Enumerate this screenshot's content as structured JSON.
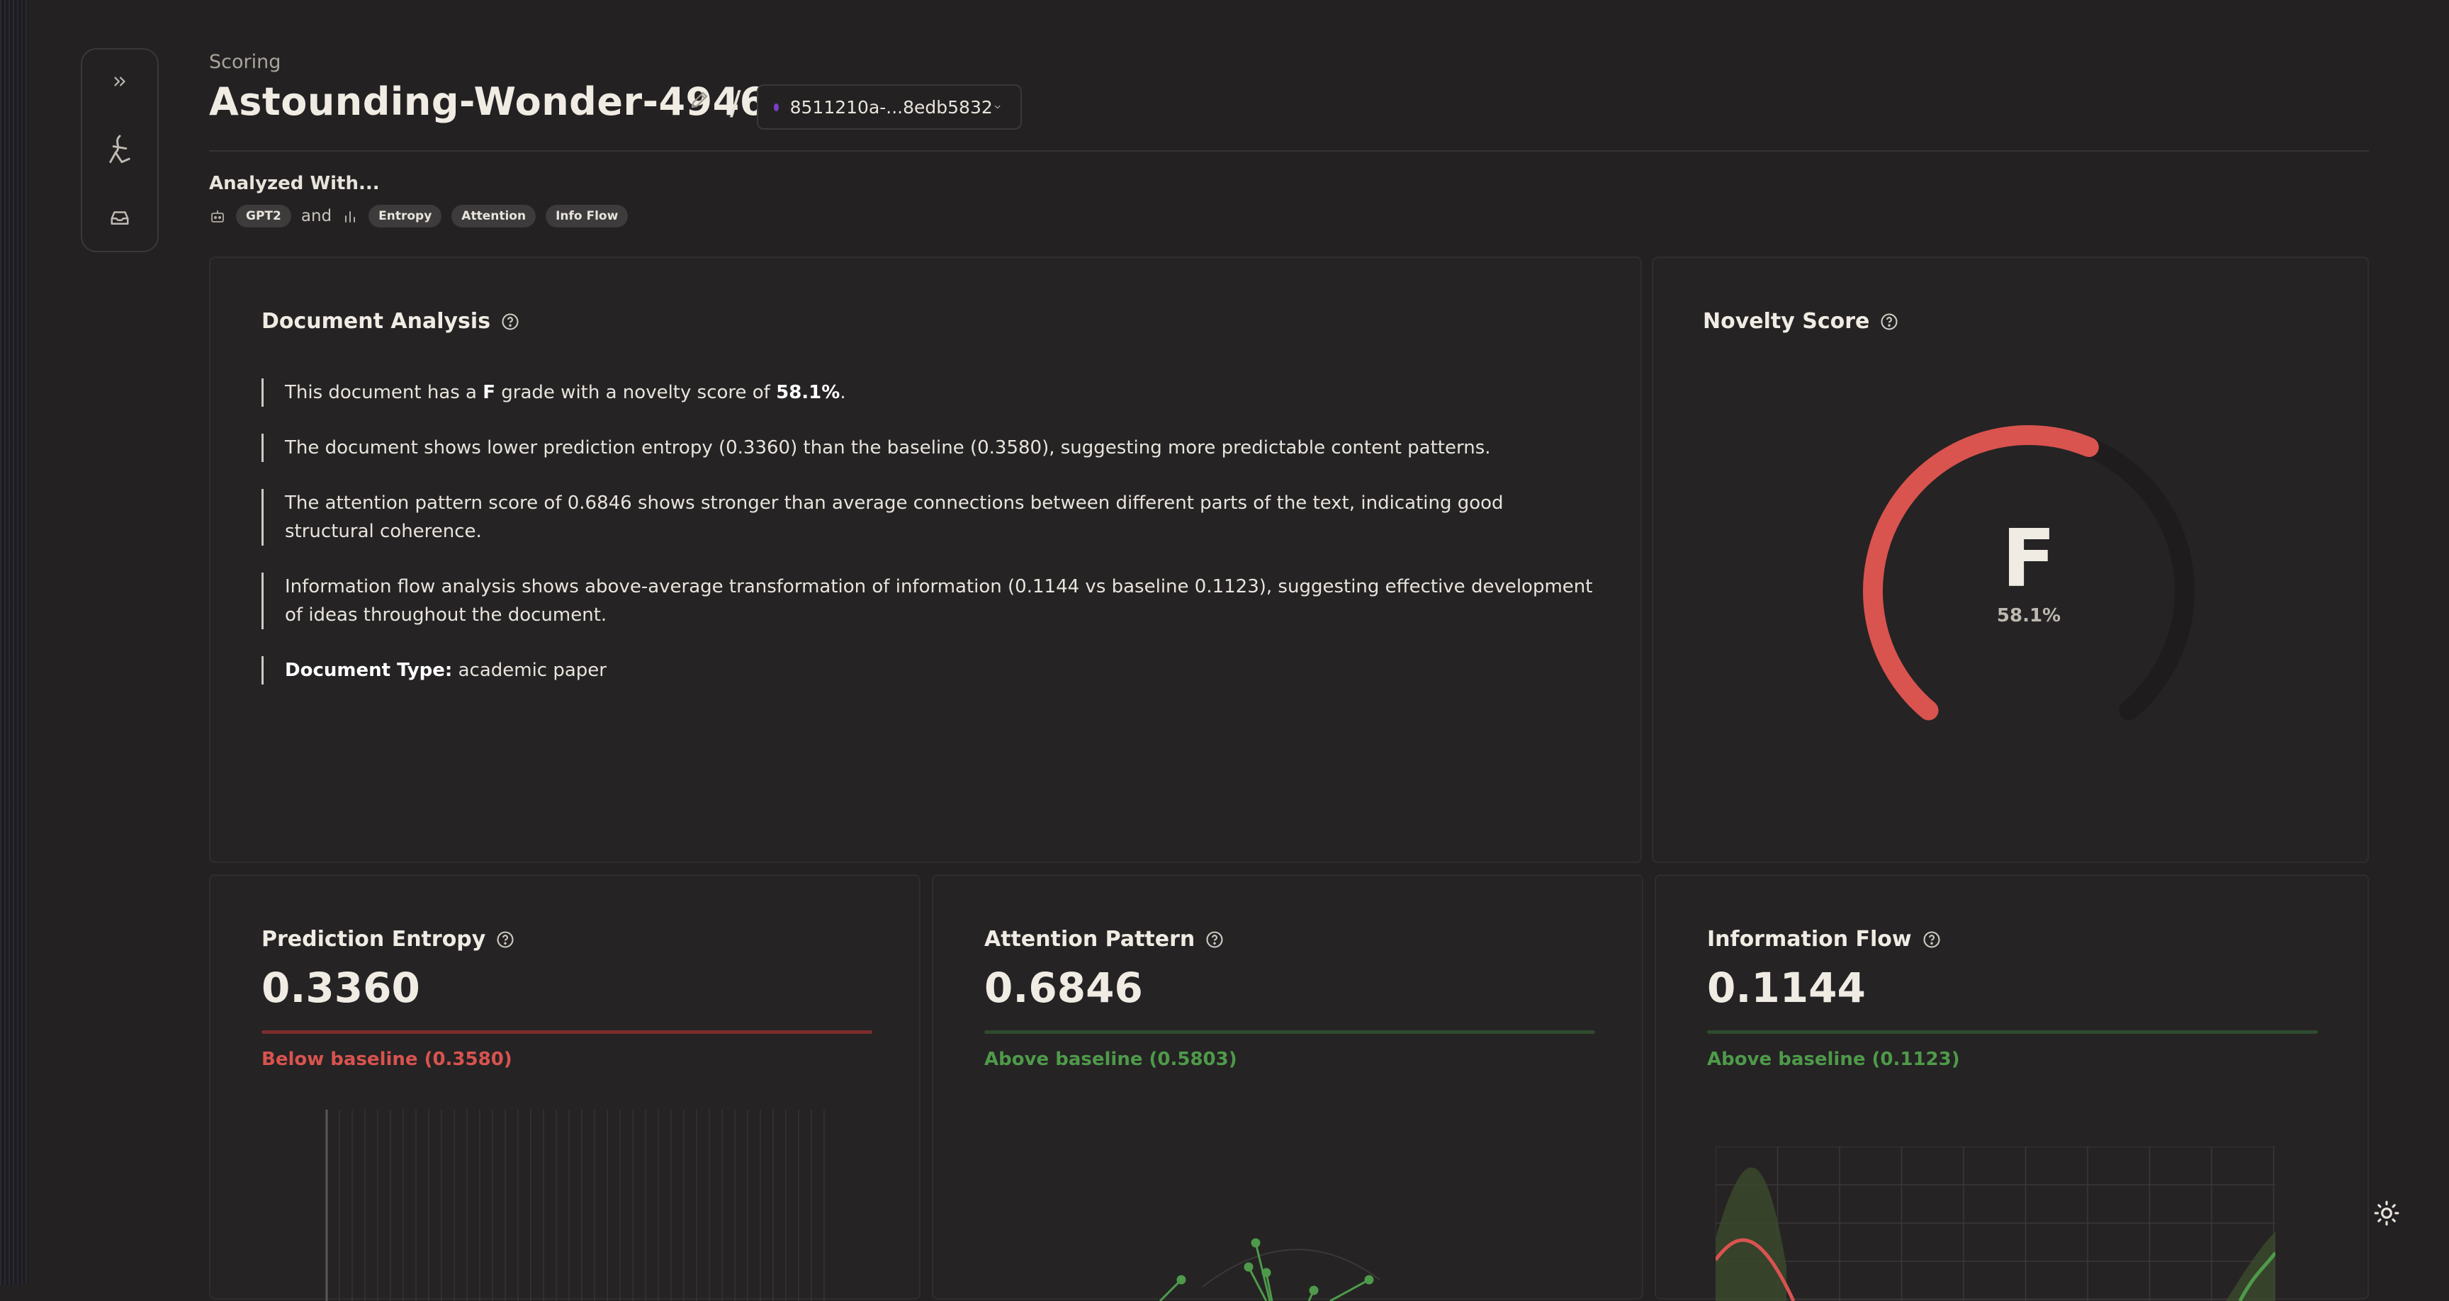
{
  "sidebar": {
    "expand_icon": "chevrons-right-icon",
    "logo_icon": "brand-logo-icon",
    "inbox_icon": "inbox-icon"
  },
  "header": {
    "section": "Scoring",
    "title": "Astounding-Wonder-4946",
    "separator": "/",
    "version_label": "8511210a-...8edb5832",
    "version_dot_color": "#7b3fc4"
  },
  "analyzed": {
    "label": "Analyzed With...",
    "model_icon": "robot-icon",
    "model_chip": "GPT2",
    "and_text": "and",
    "metrics_icon": "bar-chart-icon",
    "metric_chips": [
      "Entropy",
      "Attention",
      "Info Flow"
    ]
  },
  "document_analysis": {
    "title": "Document Analysis",
    "items": [
      {
        "pre": "This document has a ",
        "grade": "F",
        "mid": " grade with a novelty score of ",
        "score": "58.1%",
        "post": "."
      },
      {
        "text": "The document shows lower prediction entropy (0.3360) than the baseline (0.3580), suggesting more predictable content patterns."
      },
      {
        "text": "The attention pattern score of 0.6846 shows stronger than average connections between different parts of the text, indicating good structural coherence."
      },
      {
        "text": "Information flow analysis shows above-average transformation of information (0.1144 vs baseline 0.1123), suggesting effective development of ideas throughout the document."
      },
      {
        "label": "Document Type:",
        "value": " academic paper"
      }
    ]
  },
  "novelty": {
    "title": "Novelty Score",
    "grade": "F",
    "percent_label": "58.1%",
    "percent_value": 58.1,
    "arc_color": "#d9534f",
    "track_color": "#1e1c1d"
  },
  "metrics": [
    {
      "title": "Prediction Entropy",
      "value": "0.3360",
      "note": "Below baseline (0.3580)",
      "color": "#d9534f"
    },
    {
      "title": "Attention Pattern",
      "value": "0.6846",
      "note": "Above baseline (0.5803)",
      "color": "#4e9a4a"
    },
    {
      "title": "Information Flow",
      "value": "0.1144",
      "note": "Above baseline (0.1123)",
      "color": "#4e9a4a"
    }
  ],
  "theme_toggle_icon": "sun-icon"
}
